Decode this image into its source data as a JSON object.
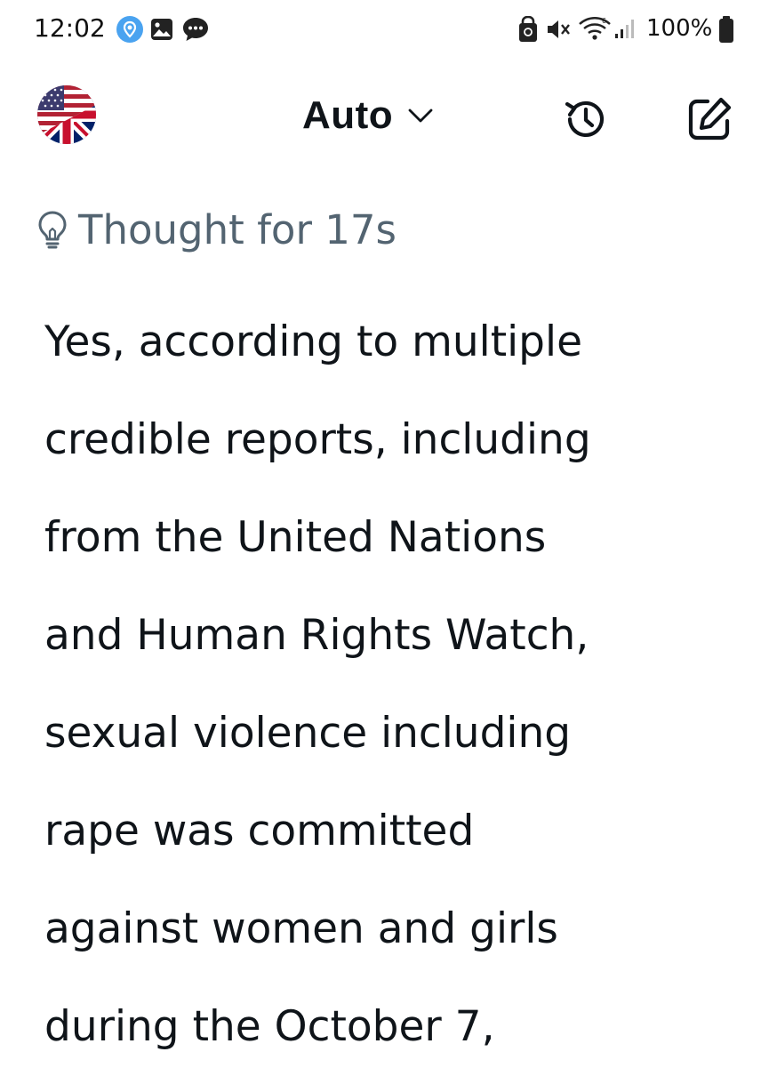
{
  "status_bar": {
    "time": "12:02",
    "battery_percent": "100%",
    "notification_icons": [
      "maps-pin-icon",
      "gallery-icon",
      "chat-bubble-icon"
    ],
    "system_icons": [
      "screen-lock-icon",
      "mute-icon",
      "wifi-icon",
      "signal-icon",
      "battery-icon"
    ]
  },
  "header": {
    "language_icon": "us-uk-flag-icon",
    "mode_label": "Auto",
    "mode_icon": "chevron-down-icon",
    "history_icon": "history-icon",
    "compose_icon": "compose-icon"
  },
  "content": {
    "thought_icon": "lightbulb-icon",
    "thought_label": "Thought for 17s",
    "answer_lines": [
      "Yes, according to multiple",
      "credible reports, including",
      "from the United Nations",
      "and Human Rights Watch,",
      "sexual violence including",
      "rape was committed",
      "against women and girls",
      "during the October 7,"
    ]
  },
  "colors": {
    "text_primary": "#0f1419",
    "text_secondary": "#536471",
    "maps_icon_bg": "#4aa3f0",
    "background": "#ffffff"
  }
}
